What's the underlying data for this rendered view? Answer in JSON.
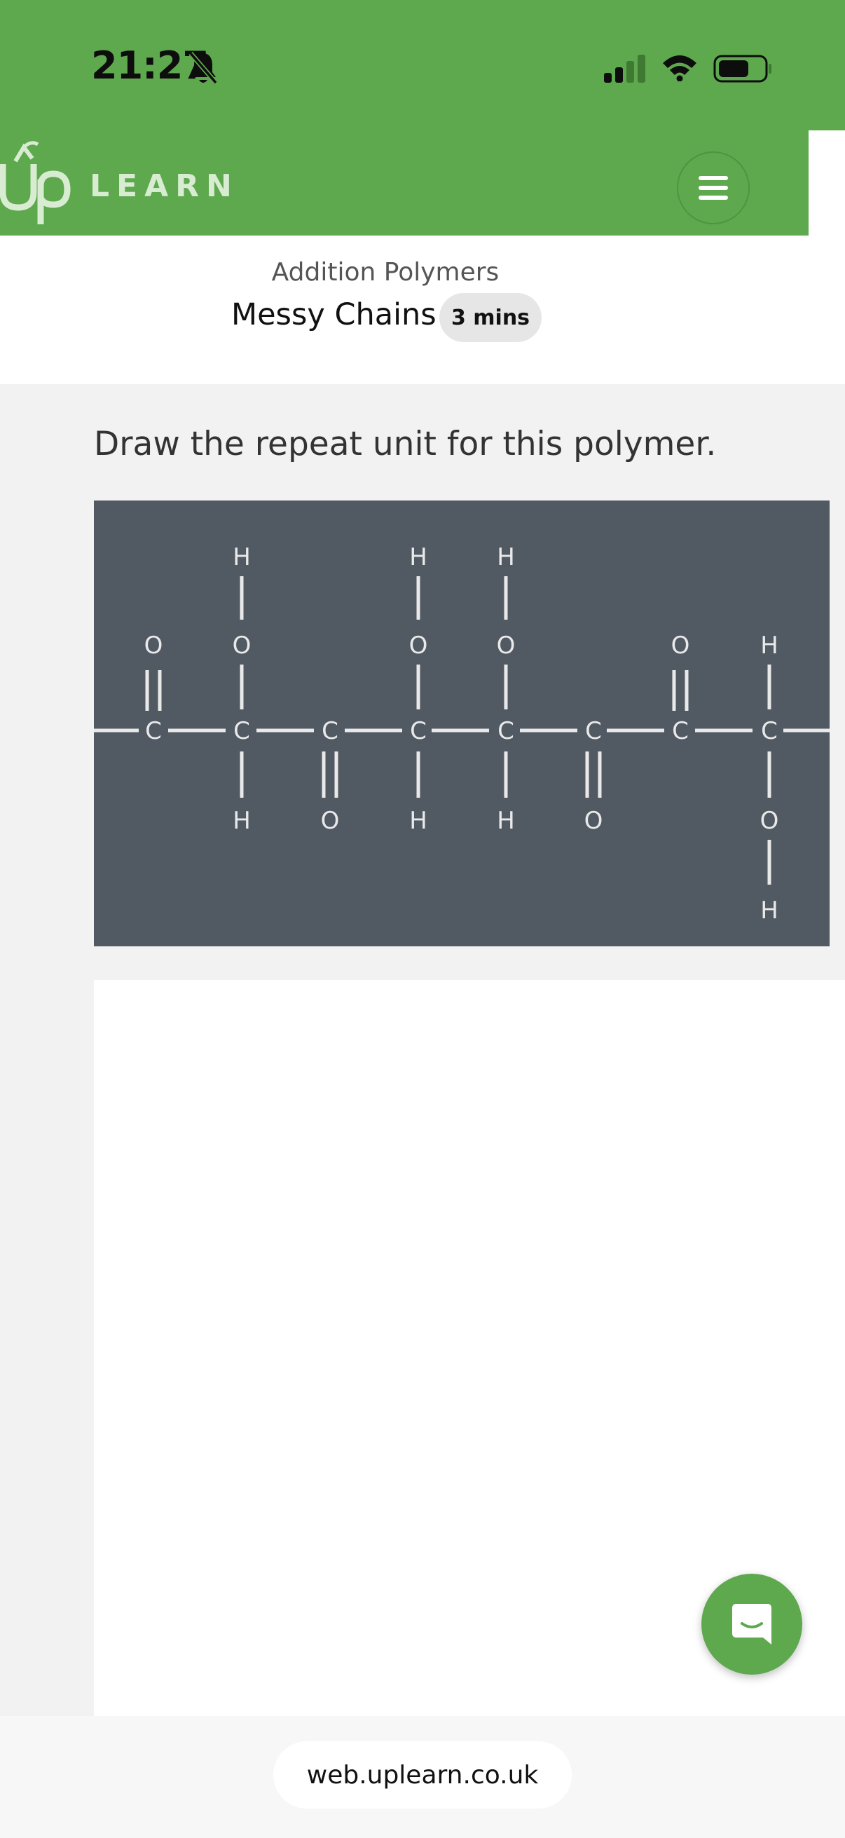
{
  "status_bar": {
    "time": "21:27",
    "icons": [
      "bell-slash-icon",
      "cellular-signal-icon",
      "wifi-icon",
      "battery-icon"
    ]
  },
  "header": {
    "logo_text": "LEARN",
    "logo_mark": "Up",
    "menu_icon": "hamburger-icon",
    "brand_color": "#5ea84e"
  },
  "lesson": {
    "topic": "Addition Polymers",
    "title": "Messy Chains",
    "duration": "3 mins"
  },
  "question": {
    "prompt": "Draw the repeat unit for this polymer."
  },
  "molecule": {
    "backbone": [
      "C",
      "C",
      "C",
      "C",
      "C",
      "C",
      "C",
      "C"
    ],
    "top_groups": [
      "O",
      "O-H",
      "",
      "O-H",
      "O-H",
      "",
      "O",
      "H"
    ],
    "bottom_groups": [
      "",
      "H",
      "O",
      "H",
      "H",
      "O",
      "",
      "O-H"
    ],
    "atoms": {
      "carbon": "C",
      "oxygen": "O",
      "hydrogen": "H"
    }
  },
  "chat": {
    "icon": "chat-bubble-icon"
  },
  "browser": {
    "url": "web.uplearn.co.uk"
  }
}
